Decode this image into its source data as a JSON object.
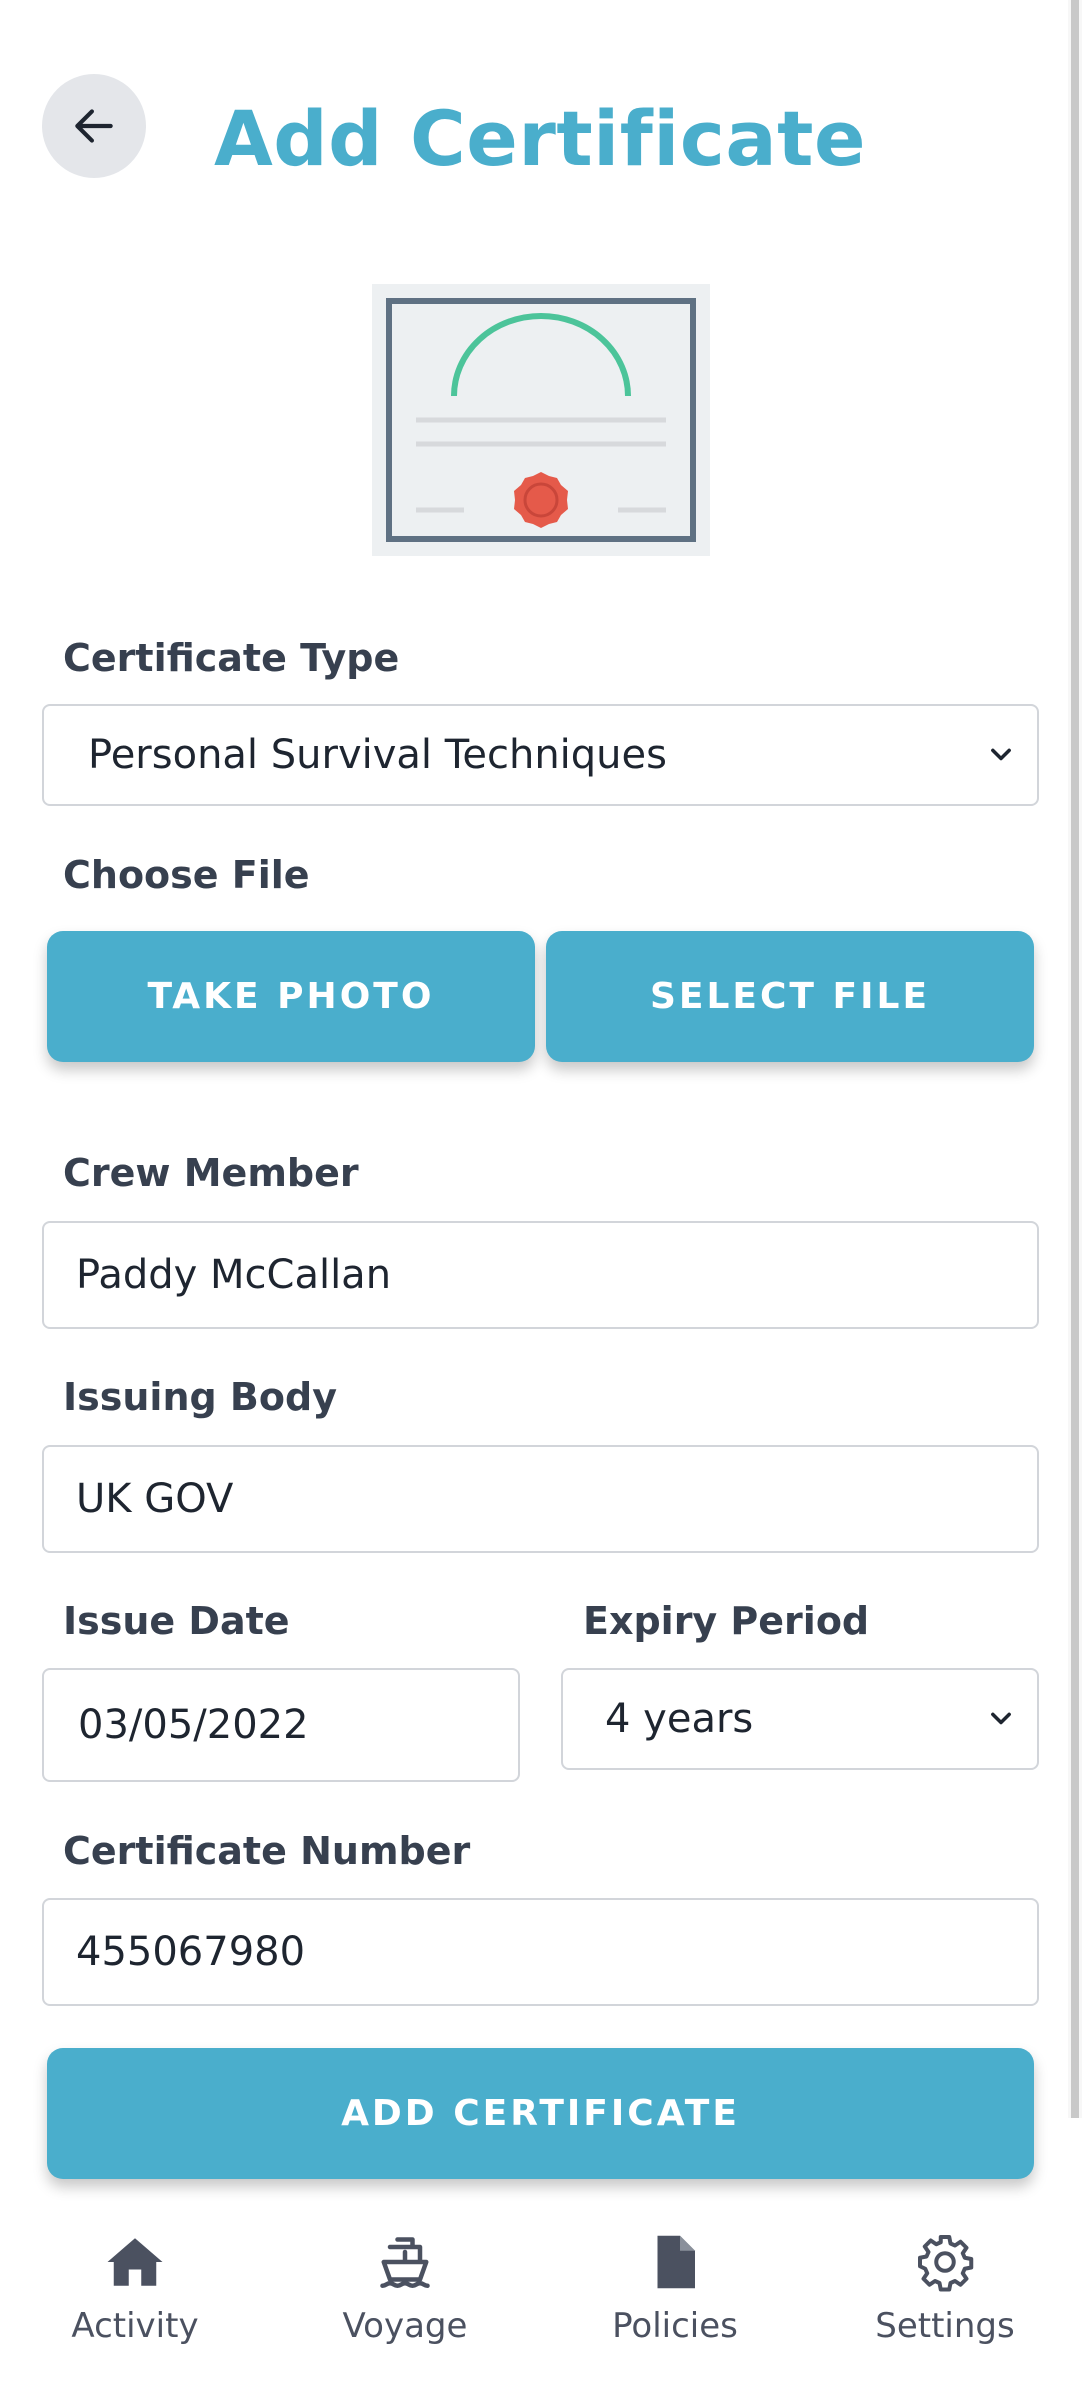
{
  "header": {
    "back_icon": "arrow-left-icon",
    "title": "Add Certificate"
  },
  "illustration": {
    "name": "certificate-illustration",
    "colors": {
      "frame": "#5f7183",
      "paper": "#edf0f2",
      "arc": "#4cc49a",
      "lines": "#d7d9dc",
      "seal": "#e55a4a"
    }
  },
  "form": {
    "certificate_type": {
      "label": "Certificate Type",
      "value": "Personal Survival Techniques"
    },
    "choose_file": {
      "label": "Choose File",
      "take_photo": "TAKE PHOTO",
      "select_file": "SELECT FILE"
    },
    "crew_member": {
      "label": "Crew Member",
      "value": "Paddy McCallan"
    },
    "issuing_body": {
      "label": "Issuing Body",
      "value": "UK GOV"
    },
    "issue_date": {
      "label": "Issue Date",
      "value": "03/05/2022"
    },
    "expiry_period": {
      "label": "Expiry Period",
      "value": "4 years"
    },
    "certificate_number": {
      "label": "Certificate Number",
      "value": "455067980"
    },
    "submit": "ADD CERTIFICATE"
  },
  "nav": {
    "items": [
      {
        "label": "Activity",
        "icon": "home-icon"
      },
      {
        "label": "Voyage",
        "icon": "ship-icon"
      },
      {
        "label": "Policies",
        "icon": "document-icon"
      },
      {
        "label": "Settings",
        "icon": "gear-icon"
      }
    ]
  },
  "colors": {
    "accent": "#4aaecc",
    "text": "#37404f"
  }
}
